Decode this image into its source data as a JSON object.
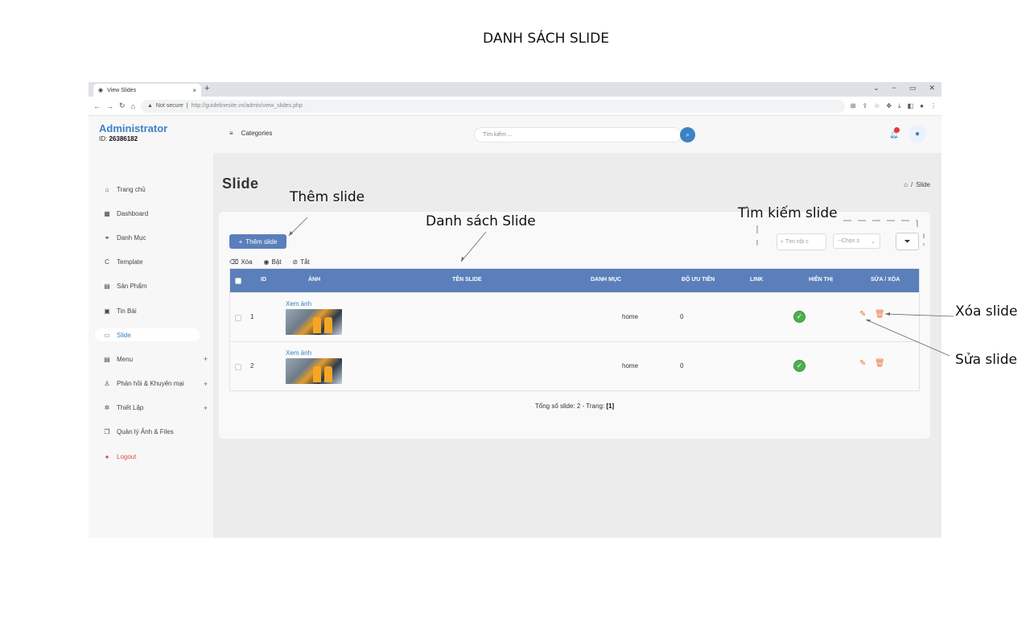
{
  "doc_title": "DANH SÁCH SLIDE",
  "annotations": {
    "add": "Thêm slide",
    "list": "Danh sách Slide",
    "search": "Tìm kiếm slide",
    "delete": "Xóa slide",
    "edit": "Sửa slide"
  },
  "browser": {
    "tab_title": "View Slides",
    "tab_close": "×",
    "tab_new": "+",
    "win_min": "−",
    "win_max": "▭",
    "win_close": "✕",
    "not_secure": "Not secure",
    "url": "http://guidelinesite.vn/admin/view_slides.php"
  },
  "sidebar": {
    "title": "Administrator",
    "id_label": "ID:",
    "id_value": "26386182",
    "items": [
      {
        "label": "Trang chủ",
        "icon": "home-icon",
        "glyph": "⌂"
      },
      {
        "label": "Dashboard",
        "icon": "dashboard-icon",
        "glyph": "▦"
      },
      {
        "label": "Danh Mục",
        "icon": "link-icon",
        "glyph": "⚭"
      },
      {
        "label": "Template",
        "icon": "template-icon",
        "glyph": "C"
      },
      {
        "label": "Sản Phẩm",
        "icon": "product-icon",
        "glyph": "▤"
      },
      {
        "label": "Tin Bài",
        "icon": "news-icon",
        "glyph": "▣"
      },
      {
        "label": "Slide",
        "icon": "slide-icon",
        "glyph": "▭"
      },
      {
        "label": "Menu",
        "icon": "menu-icon",
        "glyph": "▤",
        "plus": "+"
      },
      {
        "label": "Phản hồi & Khuyến mại",
        "icon": "user-icon",
        "glyph": "♙",
        "plus": "+"
      },
      {
        "label": "Thiết Lập",
        "icon": "gear-icon",
        "glyph": "✲",
        "plus": "+"
      },
      {
        "label": "Quản lý Ảnh & Files",
        "icon": "files-icon",
        "glyph": "❐"
      },
      {
        "label": "Logout",
        "icon": "logout-icon",
        "glyph": "●"
      }
    ]
  },
  "topbar": {
    "menu_glyph": "≡",
    "categories": "Categories",
    "search_placeholder": "Tìm kiếm ..."
  },
  "main": {
    "page_title": "Slide",
    "breadcrumb_sep": "/",
    "breadcrumb_current": "Slide",
    "add_button": "Thêm slide",
    "search_placeholder": "Tìm nội c",
    "select_value": "--Chọn s",
    "bulk": {
      "delete": "Xóa",
      "on": "Bật",
      "off": "Tắt"
    },
    "headers": {
      "id": "ID",
      "image": "ẢNH",
      "name": "TÊN SLIDE",
      "category": "DANH MỤC",
      "priority": "ĐỘ ƯU TIÊN",
      "link": "LINK",
      "display": "HIỂN THỊ",
      "actions": "SỬA / XÓA"
    },
    "rows": [
      {
        "id": "1",
        "view": "Xem ảnh",
        "name": "",
        "category": "home",
        "priority": "0",
        "link": ""
      },
      {
        "id": "2",
        "view": "Xem ảnh",
        "name": "",
        "category": "home",
        "priority": "0",
        "link": ""
      }
    ],
    "footer_text": "Tổng số slide: 2 - Trang:",
    "footer_page": "[1]"
  },
  "colors": {
    "accent": "#3b82c4",
    "table_header": "#5b7fba",
    "ok": "#4caf50",
    "action": "#e8773a"
  }
}
